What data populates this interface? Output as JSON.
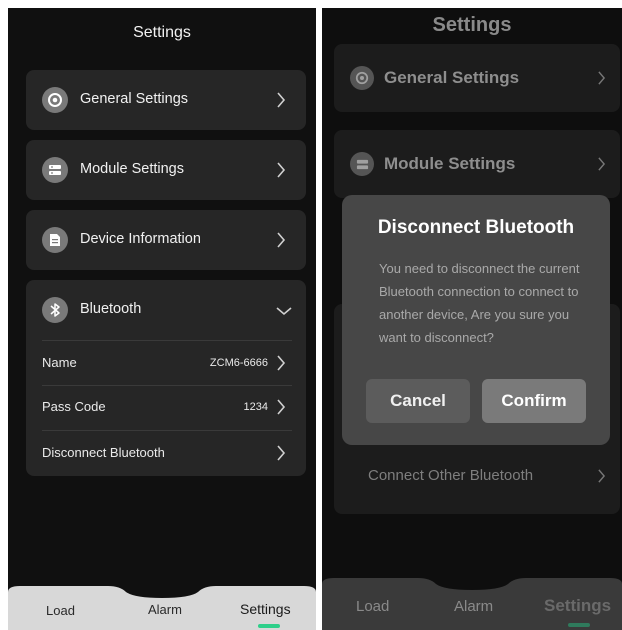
{
  "left": {
    "header_title": "Settings",
    "rows": [
      {
        "label": "General Settings",
        "icon": "gear-icon"
      },
      {
        "label": "Module Settings",
        "icon": "module-icon"
      },
      {
        "label": "Device Information",
        "icon": "document-icon"
      },
      {
        "label": "Bluetooth",
        "icon": "bluetooth-icon"
      }
    ],
    "bluetooth_items": [
      {
        "label": "Name",
        "value": "ZCM6-6666"
      },
      {
        "label": "Pass Code",
        "value": "1234"
      },
      {
        "label": "Disconnect Bluetooth",
        "value": ""
      }
    ],
    "tabs": [
      "Load",
      "Alarm",
      "Settings"
    ]
  },
  "right": {
    "header_title": "Settings",
    "rows": [
      {
        "label": "General Settings"
      },
      {
        "label": "Module Settings"
      },
      {
        "label": "Connect Other Bluetooth"
      }
    ],
    "dialog": {
      "title": "Disconnect Bluetooth",
      "message": "You need to disconnect the current Bluetooth connection to connect to another device, Are you sure you want to disconnect?",
      "cancel_label": "Cancel",
      "confirm_label": "Confirm"
    },
    "tabs": [
      "Load",
      "Alarm",
      "Settings"
    ]
  }
}
